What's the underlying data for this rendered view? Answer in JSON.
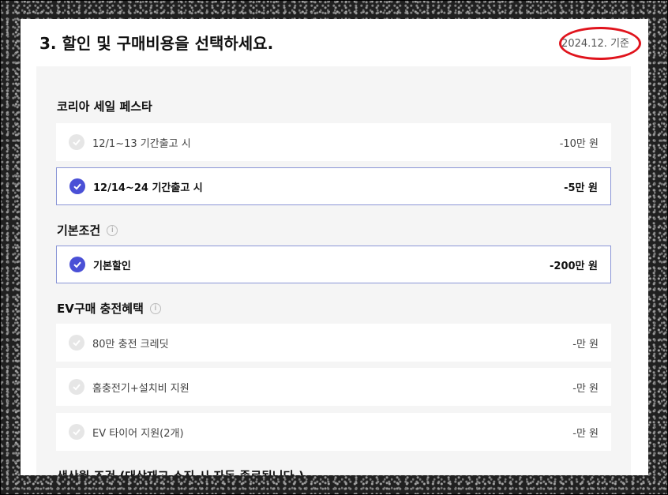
{
  "section": {
    "title": "3. 할인 및 구매비용을 선택하세요.",
    "reference_date": "2024.12. 기준"
  },
  "groups": [
    {
      "title": "코리아 세일 페스타",
      "has_info": false,
      "options": [
        {
          "label": "12/1~13 기간출고 시",
          "price": "-10만 원",
          "selected": false
        },
        {
          "label": "12/14~24 기간출고 시",
          "price": "-5만 원",
          "selected": true
        }
      ]
    },
    {
      "title": "기본조건",
      "has_info": true,
      "options": [
        {
          "label": "기본할인",
          "price": "-200만 원",
          "selected": true
        }
      ]
    },
    {
      "title": "EV구매 충전혜택",
      "has_info": true,
      "options": [
        {
          "label": "80만 충전 크레딧",
          "price": "-만 원",
          "selected": false
        },
        {
          "label": "홈충전기+설치비 지원",
          "price": "-만 원",
          "selected": false
        },
        {
          "label": "EV 타이어 지원(2개)",
          "price": "-만 원",
          "selected": false
        }
      ]
    },
    {
      "title": "생산월 조건 (대상재고 소진 시 자동 종료됩니다.)",
      "has_info": false,
      "options": []
    }
  ],
  "info_glyph": "i",
  "colors": {
    "accent": "#4a50d6",
    "highlight_circle": "#e0141d"
  },
  "icons": {
    "check": "check-icon",
    "info": "info-icon"
  }
}
